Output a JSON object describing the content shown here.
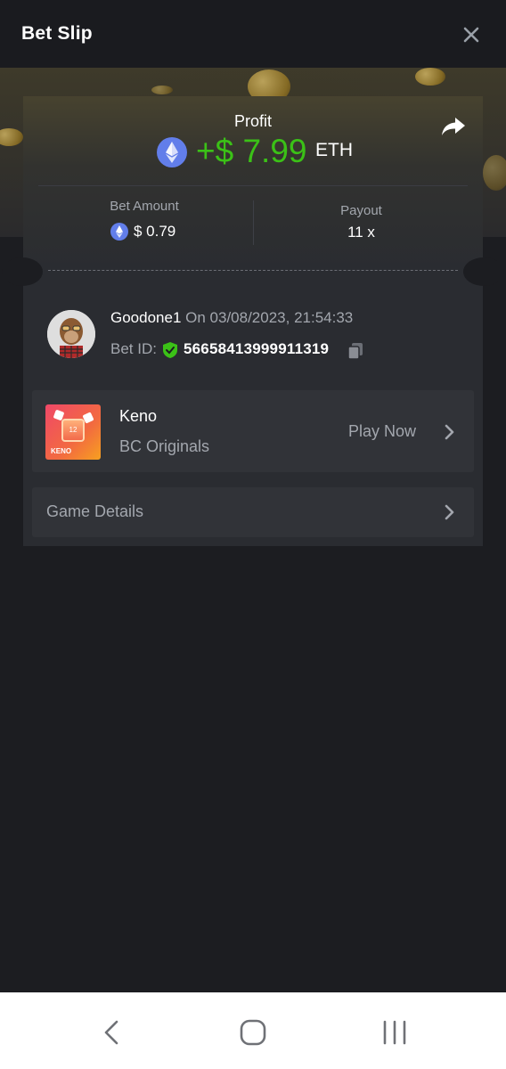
{
  "header": {
    "title": "Bet Slip",
    "close_icon": "close-icon"
  },
  "profit": {
    "label": "Profit",
    "amount": "+$ 7.99",
    "currency": "ETH",
    "color": "#3bc117"
  },
  "bet": {
    "amount_label": "Bet Amount",
    "amount_value": "$ 0.79",
    "payout_label": "Payout",
    "payout_value": "11 x"
  },
  "user": {
    "name": "Goodone1",
    "date": "On 03/08/2023, 21:54:33",
    "bet_id_label": "Bet ID:",
    "bet_id": "56658413999911319"
  },
  "game": {
    "name": "Keno",
    "provider": "BC Originals",
    "play_label": "Play Now",
    "thumb_text": "KENO",
    "thumb_tile": "12"
  },
  "details": {
    "label": "Game Details"
  },
  "icons": [
    "close-icon",
    "share-icon",
    "eth-icon",
    "shield-check-icon",
    "copy-icon",
    "chevron-right-icon",
    "nav-back-icon",
    "nav-home-icon",
    "nav-recents-icon"
  ]
}
